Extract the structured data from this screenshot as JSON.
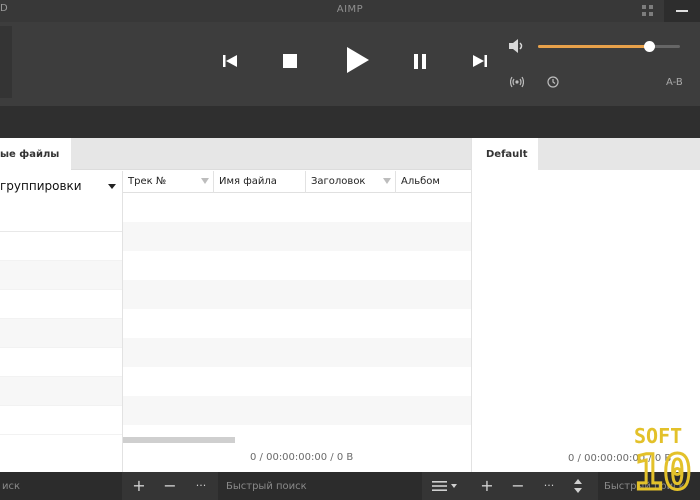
{
  "window": {
    "title": "AIMP",
    "left_glyph": "D"
  },
  "player": {
    "volume_percent": 78,
    "ab_label": "A-B",
    "accent_color": "#e8a14a"
  },
  "left_tabs": {
    "files_tab": "ые файлы"
  },
  "library": {
    "grouping_label": "группировки"
  },
  "table": {
    "columns": [
      "Трек №",
      "Имя файла",
      "Заголовок",
      "Альбом"
    ],
    "status": "0 / 00:00:00:00 / 0 B"
  },
  "right_pane": {
    "tab": "Default",
    "status": "0 / 00:00:00:00 / 0 B"
  },
  "bottom": {
    "search_left": "иск",
    "search_mid": "Быстрый поиск",
    "search_right": "Быстрый поиск",
    "add": "+",
    "remove": "−",
    "more": "···"
  },
  "watermark": {
    "line1": "SOFT",
    "line2": "10"
  }
}
